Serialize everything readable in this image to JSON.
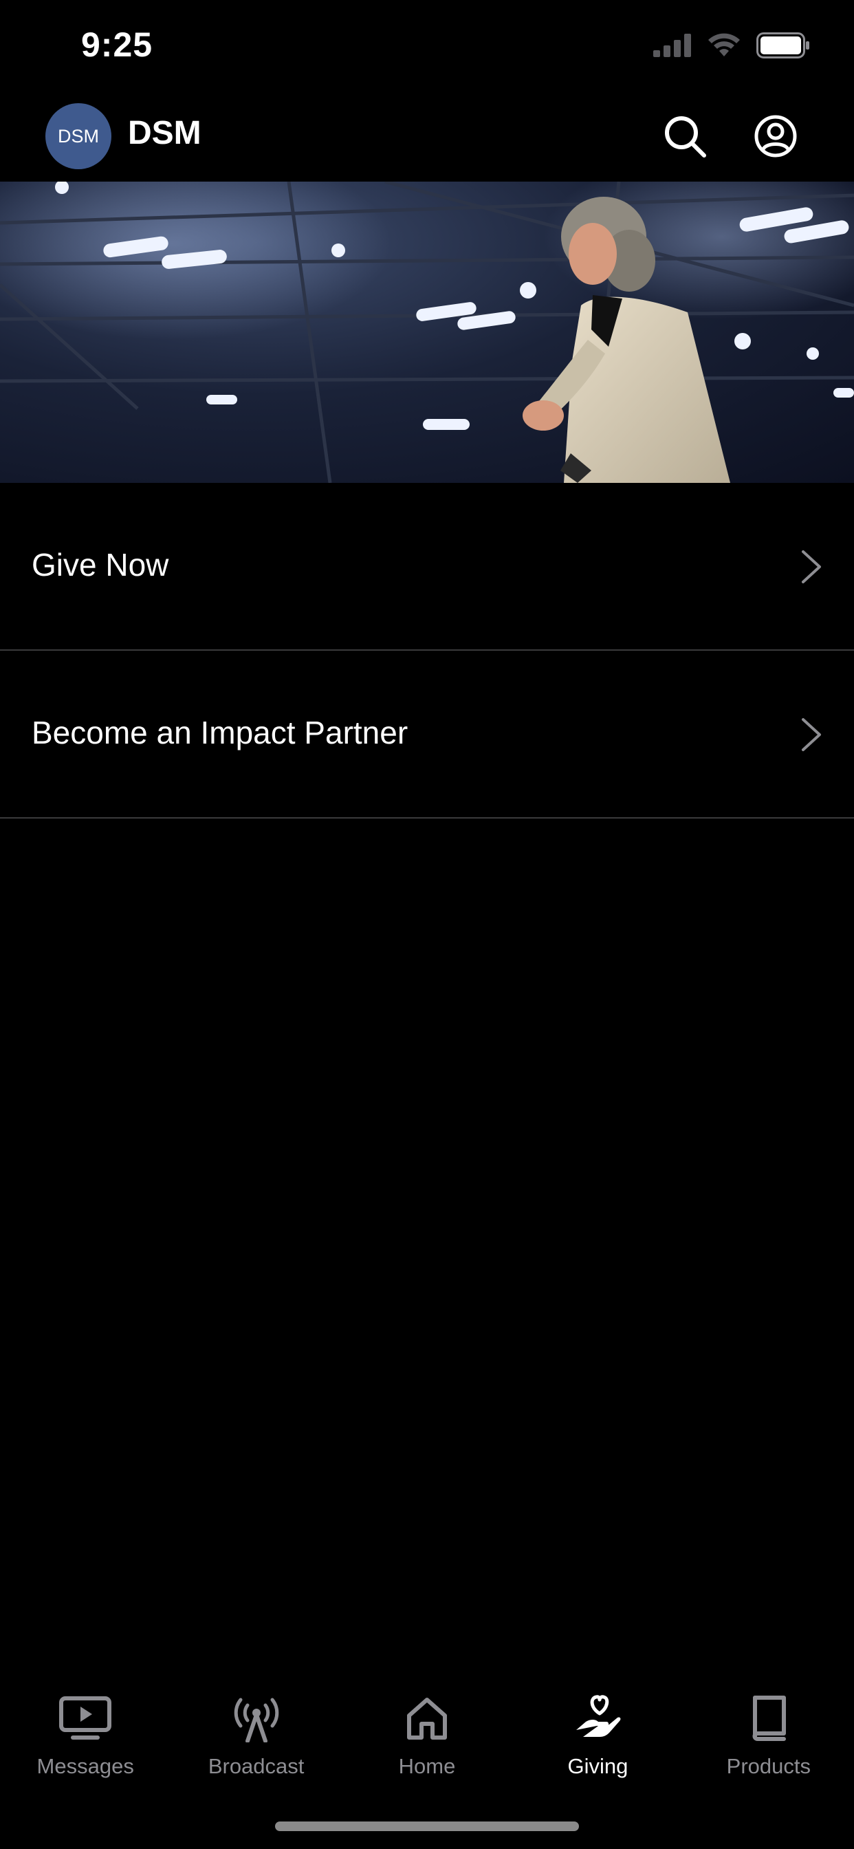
{
  "status_bar": {
    "time": "9:25",
    "icons": [
      "cellular-signal-icon",
      "wifi-icon",
      "battery-icon"
    ]
  },
  "header": {
    "avatar_text": "DSM",
    "title": "DSM",
    "search_icon": "search-icon",
    "account_icon": "account-icon"
  },
  "hero": {
    "image": "speaker-on-stage-photo"
  },
  "menu": {
    "items": [
      {
        "label": "Give Now",
        "icon": "chevron-right-icon"
      },
      {
        "label": "Become an Impact Partner",
        "icon": "chevron-right-icon"
      }
    ]
  },
  "tabs": {
    "items": [
      {
        "label": "Messages",
        "icon": "tv-play-icon",
        "active": false
      },
      {
        "label": "Broadcast",
        "icon": "broadcast-tower-icon",
        "active": false
      },
      {
        "label": "Home",
        "icon": "home-icon",
        "active": false
      },
      {
        "label": "Giving",
        "icon": "hand-heart-icon",
        "active": true
      },
      {
        "label": "Products",
        "icon": "book-icon",
        "active": false
      }
    ]
  },
  "colors": {
    "background": "#000000",
    "avatar_bg": "#3f5a8e",
    "inactive_tab": "#8e8e93",
    "active_tab": "#ffffff",
    "divider": "#3a3a3c"
  }
}
